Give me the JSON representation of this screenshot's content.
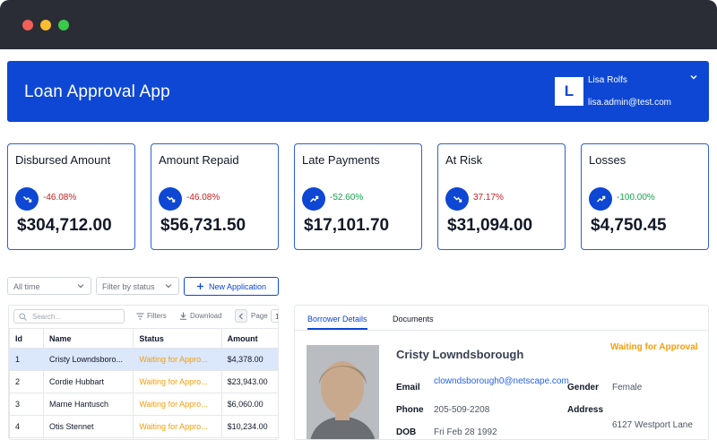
{
  "window": {
    "controls": [
      "close",
      "minimize",
      "maximize"
    ]
  },
  "header": {
    "title": "Loan Approval App",
    "user": {
      "initial": "L",
      "name": "Lisa Rolfs",
      "email": "lisa.admin@test.com"
    }
  },
  "stats": [
    {
      "title": "Disbursed Amount",
      "change": "-46.08%",
      "trend": "down",
      "value": "$304,712.00"
    },
    {
      "title": "Amount Repaid",
      "change": "-46.08%",
      "trend": "down",
      "value": "$56,731.50"
    },
    {
      "title": "Late Payments",
      "change": "-52.60%",
      "trend": "up",
      "value": "$17,101.70"
    },
    {
      "title": "At Risk",
      "change": "37.17%",
      "trend": "down",
      "value": "$31,094.00"
    },
    {
      "title": "Losses",
      "change": "-100.00%",
      "trend": "up",
      "value": "$4,750.45"
    }
  ],
  "filters": {
    "time": "All time",
    "status": "Filter by status",
    "new_application": "New Application"
  },
  "list": {
    "search_placeholder": "Search...",
    "filters_label": "Filters",
    "download_label": "Download",
    "page_label": "Page",
    "page_value": "1",
    "columns": [
      "Id",
      "Name",
      "Status",
      "Amount"
    ],
    "rows": [
      {
        "id": "1",
        "name": "Cristy Lowndsboro...",
        "status": "Waiting for Appro...",
        "amount": "$4,378.00"
      },
      {
        "id": "2",
        "name": "Cordie Hubbart",
        "status": "Waiting for Appro...",
        "amount": "$23,943.00"
      },
      {
        "id": "3",
        "name": "Marne Hantusch",
        "status": "Waiting for Appro...",
        "amount": "$6,060.00"
      },
      {
        "id": "4",
        "name": "Otis Stennet",
        "status": "Waiting for Appro...",
        "amount": "$10,234.00"
      },
      {
        "id": "",
        "name": "",
        "status": "",
        "amount": ""
      }
    ]
  },
  "detail": {
    "tabs": [
      "Borrower Details",
      "Documents"
    ],
    "name": "Cristy Lowndsborough",
    "status": "Waiting for Approval",
    "fields": {
      "email_label": "Email",
      "email": "clowndsborough0@netscape.com",
      "phone_label": "Phone",
      "phone": "205-509-2208",
      "dob_label": "DOB",
      "dob": "Fri Feb 28 1992",
      "gender_label": "Gender",
      "gender": "Female",
      "address_label": "Address",
      "address": "6127 Westport Lane"
    }
  },
  "colors": {
    "primary": "#0d47d4",
    "negative": "#c81e1e",
    "positive": "#16a34a",
    "warning": "#f59e0b"
  }
}
